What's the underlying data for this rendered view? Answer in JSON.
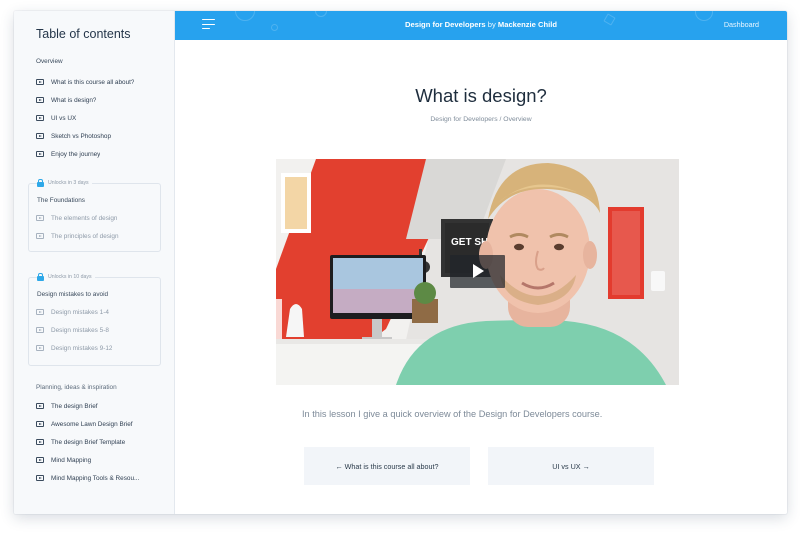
{
  "sidebar": {
    "title": "Table of contents",
    "sections": [
      {
        "label": "Overview",
        "items": [
          "What is this course all about?",
          "What is design?",
          "UI vs UX",
          "Sketch vs Photoshop",
          "Enjoy the journey"
        ]
      },
      {
        "unlock": "Unlocks in 3 days",
        "label": "The Foundations",
        "items": [
          "The elements of design",
          "The principles of design"
        ]
      },
      {
        "unlock": "Unlocks in 10 days",
        "label": "Design mistakes to avoid",
        "items": [
          "Design mistakes 1-4",
          "Design mistakes 5-8",
          "Design mistakes 9-12"
        ]
      },
      {
        "label": "Planning, ideas & inspiration",
        "items": [
          "The design Brief",
          "Awesome Lawn Design Brief",
          "The design Brief Template",
          "Mind Mapping",
          "Mind Mapping Tools & Resou..."
        ]
      }
    ]
  },
  "header": {
    "course": "Design for Developers",
    "by": "by",
    "author": "Mackenzie Child",
    "dashboard": "Dashboard",
    "menu_icon": "hamburger-menu-icon"
  },
  "main": {
    "title": "What is design?",
    "breadcrumb": {
      "course": "Design for Developers",
      "sep": " / ",
      "section": "Overview"
    },
    "video": {
      "play_icon": "play-icon",
      "poster_text": "GET SHIT DONE"
    },
    "description": "In this lesson I give a quick overview of the Design for Developers course.",
    "prev_label": "← What is this course all about?",
    "next_label": "UI vs UX →"
  },
  "colors": {
    "header": "#27a2ee",
    "lock": "#2ea8e8",
    "sidebar_bg": "#f7f9fb",
    "wall_red": "#e2402f",
    "shirt": "#7ecfae"
  }
}
